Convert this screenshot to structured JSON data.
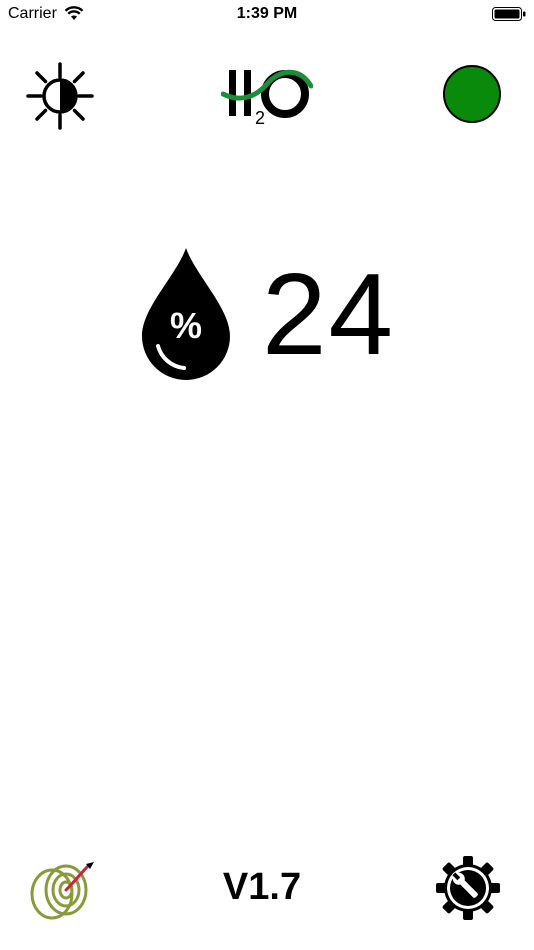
{
  "status_bar": {
    "carrier": "Carrier",
    "time": "1:39 PM"
  },
  "header": {
    "brightness_icon": "brightness-icon",
    "logo": {
      "icon": "h2o-logo",
      "text": "H2O"
    },
    "status_indicator": {
      "color": "#0a8a0a",
      "icon": "status-light"
    }
  },
  "reading": {
    "icon": "humidity-drop-icon",
    "value": "24"
  },
  "footer": {
    "spool_icon": "spool-icon",
    "version": "V1.7",
    "settings_icon": "settings-gear-icon"
  }
}
